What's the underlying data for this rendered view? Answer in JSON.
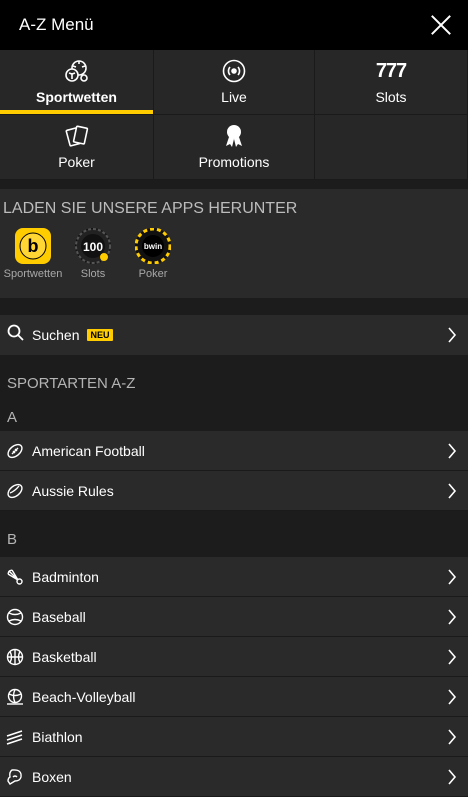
{
  "header": {
    "title": "A-Z Menü"
  },
  "tiles": [
    {
      "label": "Sportwetten",
      "icon": "sports-balls-icon",
      "active": true
    },
    {
      "label": "Live",
      "icon": "live-broadcast-icon",
      "active": false
    },
    {
      "label": "Slots",
      "icon": "777",
      "active": false
    },
    {
      "label": "Poker",
      "icon": "cards-icon",
      "active": false
    },
    {
      "label": "Promotions",
      "icon": "award-ribbon-icon",
      "active": false
    }
  ],
  "apps": {
    "heading": "LADEN SIE UNSERE APPS HERUNTER",
    "items": [
      {
        "label": "Sportwetten",
        "icon": "bwin-sports-app-icon"
      },
      {
        "label": "Slots",
        "icon": "slots-app-icon",
        "badge": "100"
      },
      {
        "label": "Poker",
        "icon": "poker-app-icon",
        "brand": "bwin"
      }
    ]
  },
  "search": {
    "label": "Suchen",
    "badge": "NEU"
  },
  "sports": {
    "heading": "SPORTARTEN A-Z",
    "groups": [
      {
        "letter": "A",
        "items": [
          "American Football",
          "Aussie Rules"
        ]
      },
      {
        "letter": "B",
        "items": [
          "Badminton",
          "Baseball",
          "Basketball",
          "Beach-Volleyball",
          "Biathlon",
          "Boxen"
        ]
      }
    ]
  },
  "colors": {
    "accent": "#ffcc00",
    "background": "#1c1c1c",
    "row": "#2a2a2a"
  }
}
